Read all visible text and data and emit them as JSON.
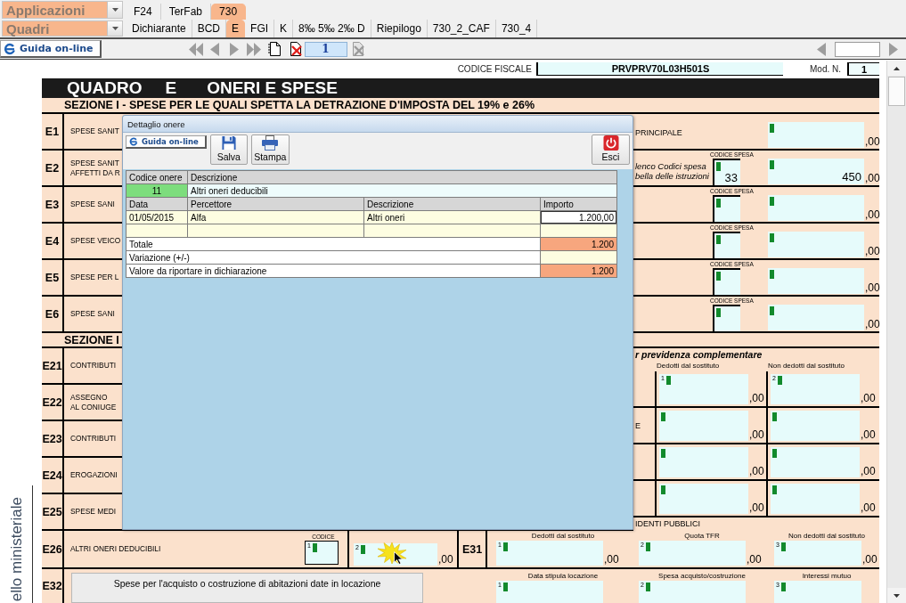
{
  "app_bar": {
    "applications": "Applicazioni",
    "app_tabs": [
      {
        "label": "F24",
        "selected": false
      },
      {
        "label": "TerFab",
        "selected": false
      },
      {
        "label": "730",
        "selected": true
      }
    ],
    "quadri": "Quadri",
    "quadri_tabs": [
      {
        "label": "Dichiarante",
        "selected": false
      },
      {
        "label": "BCD",
        "selected": false
      },
      {
        "label": "E",
        "selected": true
      },
      {
        "label": "FGI",
        "selected": false
      },
      {
        "label": "K",
        "selected": false
      },
      {
        "label": "8‰ 5‰ 2‰ D",
        "selected": false
      },
      {
        "label": "Riepilogo",
        "selected": false
      },
      {
        "label": "730_2_CAF",
        "selected": false
      },
      {
        "label": "730_4",
        "selected": false
      }
    ]
  },
  "nav_bar": {
    "help_button": "Guida on-line",
    "page": "1"
  },
  "form": {
    "side_label": "ello ministeriale",
    "codice_fiscale": {
      "label": "CODICE FISCALE",
      "value": "PRVPRV70L03H501S"
    },
    "mod_n": {
      "label": "Mod. N.",
      "value": "1"
    },
    "title": {
      "quadro": "QUADRO",
      "letter": "E",
      "name": "ONERI E SPESE"
    },
    "section_1": {
      "heading": "SEZIONE I - SPESE PER LE QUALI SPETTA LA DETRAZIONE D'IMPOSTA DEL 19% e 26%",
      "rows": [
        {
          "code": "E1",
          "label_lines": [
            "SPESE SANIT"
          ],
          "note": {
            "lines": [
              "PRINCIPALE"
            ],
            "italic": false
          },
          "amount": {
            "decimals": ",00"
          }
        },
        {
          "code": "E2",
          "label_lines": [
            "SPESE SANIT",
            "AFFETTI DA R"
          ],
          "note": {
            "lines": [
              "lenco Codici spesa",
              "bella delle istruzioni"
            ],
            "italic": true
          },
          "codice": {
            "label": "CODICE SPESA",
            "value": "33"
          },
          "amount": {
            "value": "450",
            "decimals": ",00"
          }
        },
        {
          "code": "E3",
          "label_lines": [
            "SPESE SANI"
          ],
          "codice": {
            "label": "CODICE SPESA"
          },
          "amount": {
            "decimals": ",00"
          }
        },
        {
          "code": "E4",
          "label_lines": [
            "SPESE VEICO"
          ],
          "codice": {
            "label": "CODICE SPESA"
          },
          "amount": {
            "decimals": ",00"
          }
        },
        {
          "code": "E5",
          "label_lines": [
            "SPESE PER L"
          ],
          "codice": {
            "label": "CODICE SPESA"
          },
          "amount": {
            "decimals": ",00"
          }
        },
        {
          "code": "E6",
          "label_lines": [
            "SPESE SANI"
          ],
          "codice": {
            "label": "CODICE SPESA"
          },
          "amount": {
            "decimals": ",00"
          }
        }
      ]
    },
    "section_2": {
      "heading": "SEZIONE I",
      "rows": [
        {
          "code": "E21",
          "label_lines": [
            "CONTRIBUTI"
          ]
        },
        {
          "code": "E22",
          "label_lines": [
            "ASSEGNO",
            "AL CONIUGE"
          ]
        },
        {
          "code": "E23",
          "label_lines": [
            "CONTRIBUTI"
          ]
        },
        {
          "code": "E24",
          "label_lines": [
            "EROGAZIONI"
          ]
        },
        {
          "code": "E25",
          "label_lines": [
            "SPESE MEDI"
          ]
        }
      ],
      "pension_block": {
        "title": "r previdenza complementare",
        "columns": [
          "Dedotti dal sostituto",
          "Non dedotti dal sostituto"
        ],
        "rows": [
          {
            "fields": [
              {
                "number": "1",
                "decimals": ",00"
              },
              {
                "number": "2",
                "decimals": ",00"
              }
            ]
          },
          {
            "stub": "E",
            "fields": [
              {
                "decimals": ",00"
              },
              {
                "decimals": ",00"
              }
            ]
          },
          {
            "fields": [
              {
                "decimals": ",00"
              },
              {
                "decimals": ",00"
              }
            ]
          },
          {
            "fields": [
              {
                "decimals": ",00"
              },
              {
                "decimals": ",00"
              }
            ]
          }
        ],
        "footer": "IDENTI PUBBLICI"
      }
    },
    "e26": {
      "code": "E26",
      "label": "ALTRI ONERI DEDUCIBILI",
      "codice": {
        "label": "CODICE",
        "number": "1"
      },
      "amount": {
        "number": "2",
        "decimals": ",00",
        "clicked": true
      }
    },
    "e31": {
      "code": "E31",
      "fields": [
        {
          "header": "Dedotti dal sostituto",
          "number": "1",
          "decimals": ",00"
        },
        {
          "header": "Quota TFR",
          "number": "2",
          "decimals": ",00"
        },
        {
          "header": "Non dedotti dal sostituto",
          "number": "3",
          "decimals": ",00"
        }
      ]
    },
    "e32": {
      "code": "E32",
      "description": "Spese per l'acquisto o costruzione di abitazioni date in locazione",
      "fields": [
        {
          "header": "Data stipula locazione",
          "number": "1"
        },
        {
          "header": "Spesa acquisto/costruzione",
          "number": "2"
        },
        {
          "header": "Interessi mutuo",
          "number": "3"
        }
      ]
    }
  },
  "dialog": {
    "title": "Dettaglio onere",
    "help_button": "Guida on-line",
    "actions": [
      {
        "label": "Salva",
        "kind": "save"
      },
      {
        "label": "Stampa",
        "kind": "print"
      }
    ],
    "exit_button": "Esci",
    "code_header": "Codice onere",
    "description_header": "Descrizione",
    "code": "11",
    "description": "Altri oneri deducibili",
    "columns": [
      "Data",
      "Percettore",
      "Descrizione",
      "Importo"
    ],
    "rows": [
      {
        "kind": "entry",
        "date": "01/05/2015",
        "payee": "Alfa",
        "description": "Altri oneri",
        "amount": "1.200,00"
      },
      {
        "kind": "blank"
      }
    ],
    "totals": [
      {
        "kind": "computed",
        "label": "Totale",
        "value": "1.200"
      },
      {
        "kind": "input",
        "label": "Variazione (+/-)"
      },
      {
        "kind": "computed",
        "label": "Valore da riportare in dichiarazione",
        "value": "1.200"
      }
    ]
  }
}
